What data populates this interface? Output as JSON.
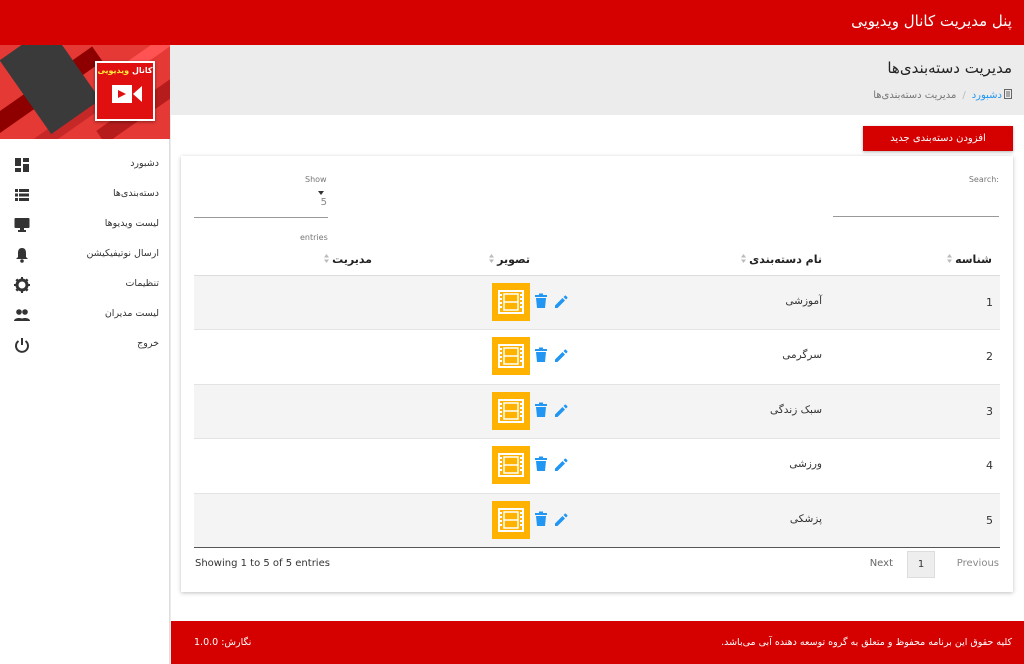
{
  "app": {
    "title": "پنل مدیریت کانال ویدیویی"
  },
  "logo": {
    "brand_a": "کانال",
    "brand_b": "ویدیویی",
    "icon": "video-camera-icon"
  },
  "sidebar": {
    "items": [
      {
        "label": "دشبورد",
        "icon": "dashboard-icon"
      },
      {
        "label": "دسته‌بندی‌ها",
        "icon": "list-icon"
      },
      {
        "label": "لیست ویدیوها",
        "icon": "monitor-icon"
      },
      {
        "label": "ارسال نوتیفیکیشن",
        "icon": "bell-icon"
      },
      {
        "label": "تنظیمات",
        "icon": "gear-icon"
      },
      {
        "label": "لیست مدیران",
        "icon": "users-icon"
      },
      {
        "label": "خروج",
        "icon": "power-icon"
      }
    ]
  },
  "page": {
    "title": "مدیریت دسته‌بندی‌ها",
    "breadcrumb_home": "دشبورد",
    "breadcrumb_current": "مدیریت دسته‌بندی‌ها"
  },
  "actions": {
    "add_label": "افزودن دسته‌بندی جدید"
  },
  "table": {
    "search_label": "Search:",
    "show_label": "Show",
    "show_value": "5",
    "entries_label": "entries",
    "headers": {
      "id": "شناسه",
      "name": "نام دسته‌بندی",
      "image": "تصویر",
      "manage": "مدیریت"
    },
    "rows": [
      {
        "id": "1",
        "name": "آموزشی"
      },
      {
        "id": "2",
        "name": "سرگرمی"
      },
      {
        "id": "3",
        "name": "سبک زندگی"
      },
      {
        "id": "4",
        "name": "ورزشی"
      },
      {
        "id": "5",
        "name": "پزشکی"
      }
    ],
    "info": "Showing 1 to 5 of 5 entries",
    "pager": {
      "previous": "Previous",
      "current": "1",
      "next": "Next"
    }
  },
  "footer": {
    "copyright": "کلیه حقوق این برنامه محفوظ و متعلق به گروه توسعه دهنده آبی می‌باشد.",
    "version": "نگارش: 1.0.0"
  },
  "colors": {
    "primary": "#d50000",
    "accent": "#2196f3",
    "thumb": "#ffb300"
  }
}
